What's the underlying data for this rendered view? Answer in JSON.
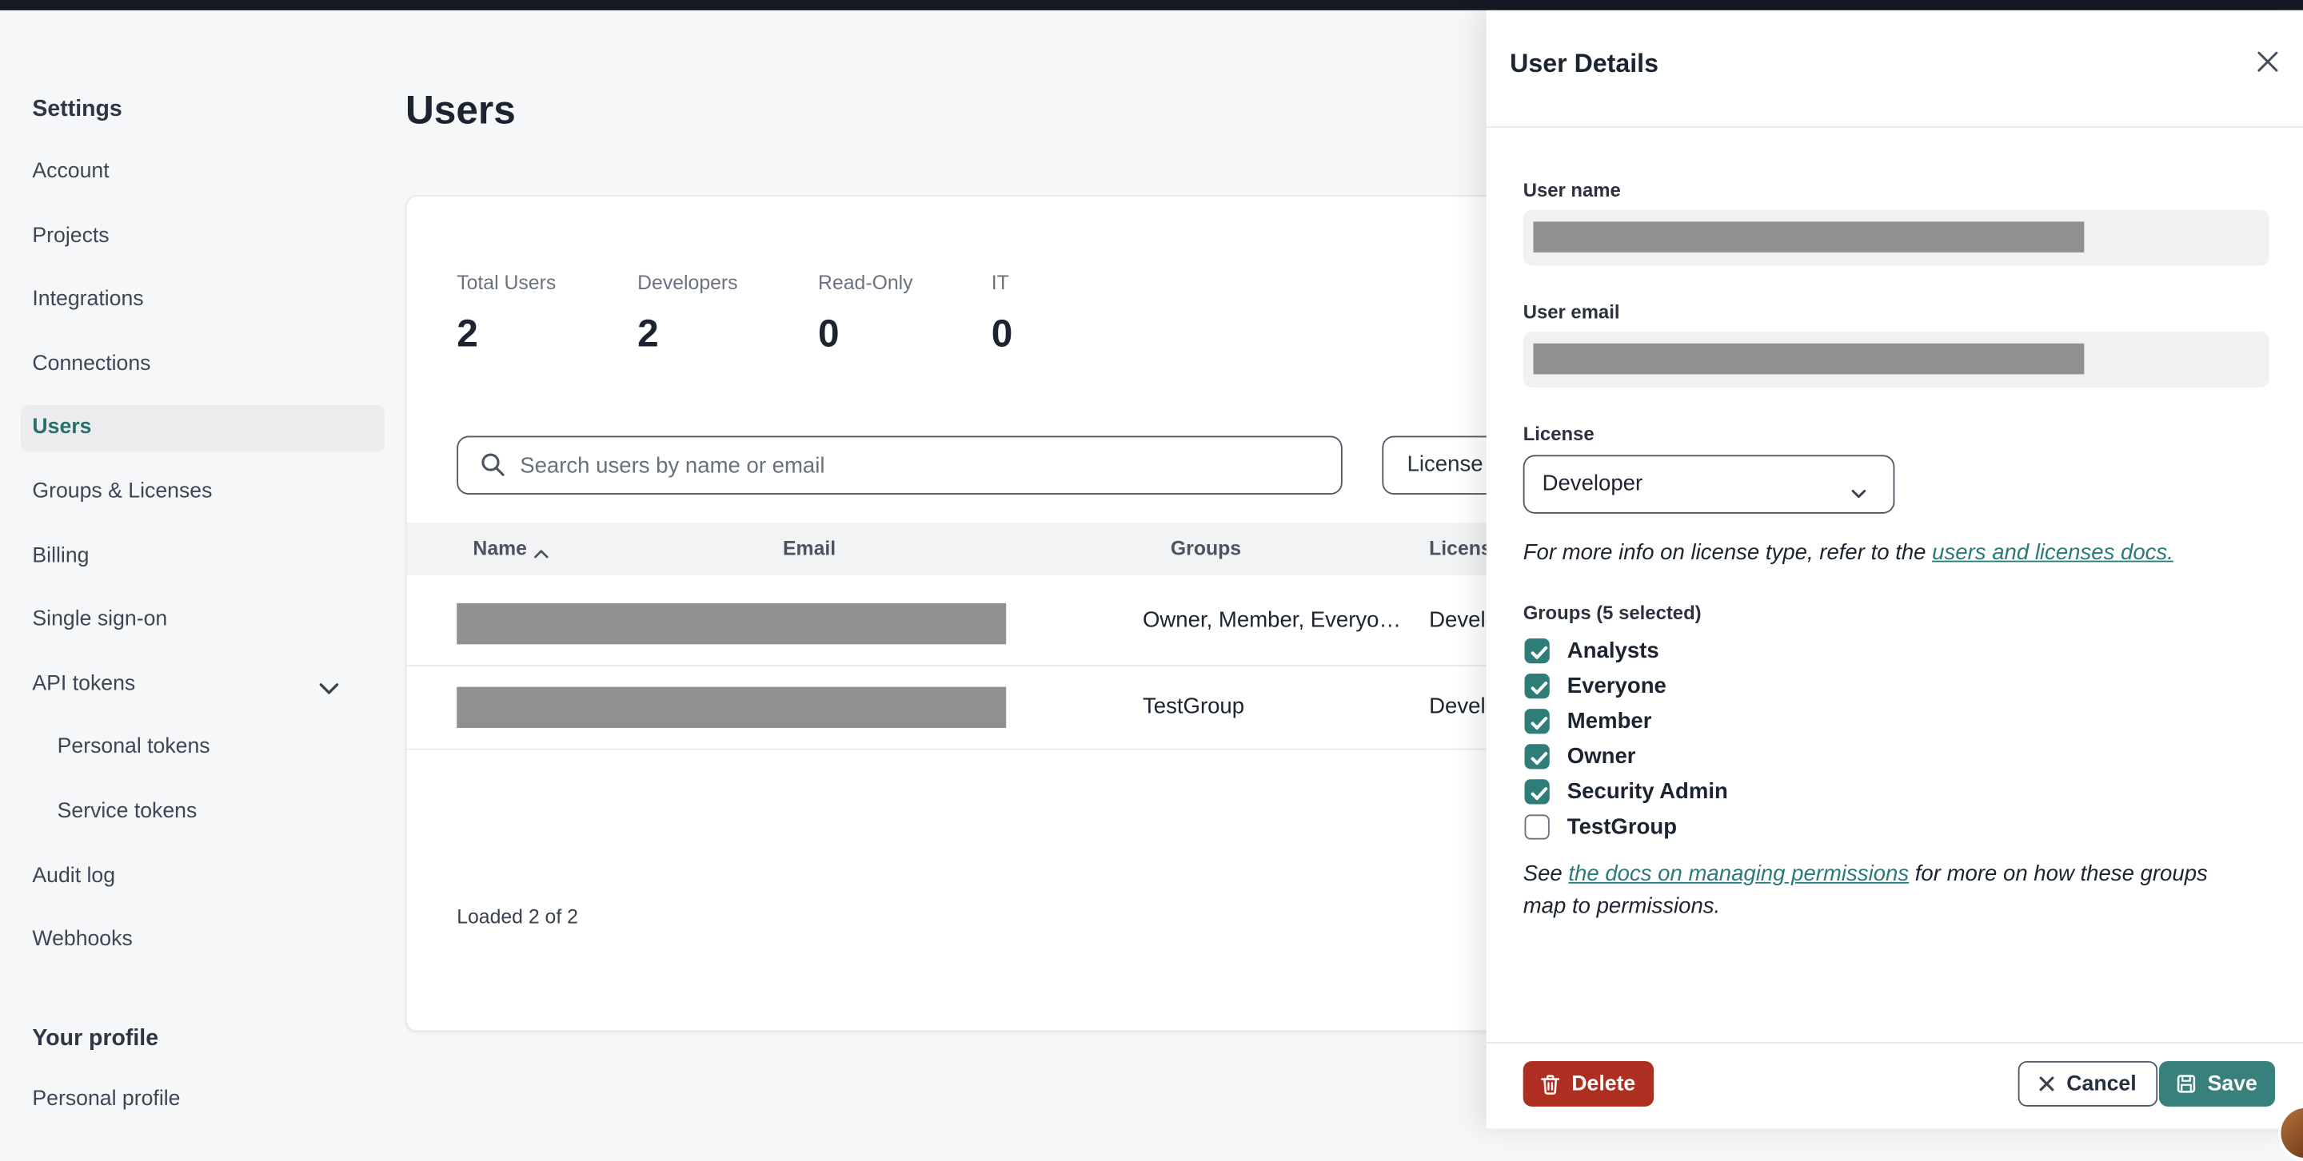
{
  "topbar": {},
  "sidebar": {
    "settings_heading": "Settings",
    "items": [
      {
        "label": "Account"
      },
      {
        "label": "Projects"
      },
      {
        "label": "Integrations"
      },
      {
        "label": "Connections"
      },
      {
        "label": "Users",
        "active": true
      },
      {
        "label": "Groups & Licenses"
      },
      {
        "label": "Billing"
      },
      {
        "label": "Single sign-on"
      },
      {
        "label": "API tokens",
        "has_chevron": true
      },
      {
        "label": "Personal tokens",
        "indented": true
      },
      {
        "label": "Service tokens",
        "indented": true
      },
      {
        "label": "Audit log"
      },
      {
        "label": "Webhooks"
      }
    ],
    "profile_heading": "Your profile",
    "profile_item": {
      "label": "Personal profile"
    }
  },
  "main": {
    "title": "Users",
    "stats": [
      {
        "label": "Total Users",
        "value": "2"
      },
      {
        "label": "Developers",
        "value": "2"
      },
      {
        "label": "Read-Only",
        "value": "0"
      },
      {
        "label": "IT",
        "value": "0"
      }
    ],
    "search_placeholder": "Search users by name or email",
    "license_filter_label": "License",
    "table": {
      "columns": [
        "Name",
        "Email",
        "Groups",
        "License"
      ],
      "rows": [
        {
          "redacted": true,
          "groups": "Owner, Member, Everyo…",
          "license": "Developer"
        },
        {
          "redacted": true,
          "groups": "TestGroup",
          "license": "Developer"
        }
      ]
    },
    "loaded_text": "Loaded 2 of 2"
  },
  "drawer": {
    "title": "User Details",
    "user_name_label": "User name",
    "user_name_redacted": true,
    "user_email_label": "User email",
    "user_email_redacted": true,
    "license_label": "License",
    "license_value": "Developer",
    "license_info_prefix": "For more info on license type, refer to the ",
    "license_info_link": "users and licenses docs.",
    "groups_label": "Groups (5 selected)",
    "groups": [
      {
        "label": "Analysts",
        "checked": true
      },
      {
        "label": "Everyone",
        "checked": true
      },
      {
        "label": "Member",
        "checked": true
      },
      {
        "label": "Owner",
        "checked": true
      },
      {
        "label": "Security Admin",
        "checked": true
      },
      {
        "label": "TestGroup",
        "checked": false
      }
    ],
    "note_prefix": "See ",
    "note_link": "the docs on managing permissions",
    "note_suffix": " for more on how these groups map to permissions.",
    "delete_label": "Delete",
    "cancel_label": "Cancel",
    "save_label": "Save"
  },
  "colors": {
    "accent_teal": "#2e7d79",
    "danger_red": "#ae2e21",
    "topbar": "#141925",
    "link_teal": "#2b7a76"
  }
}
